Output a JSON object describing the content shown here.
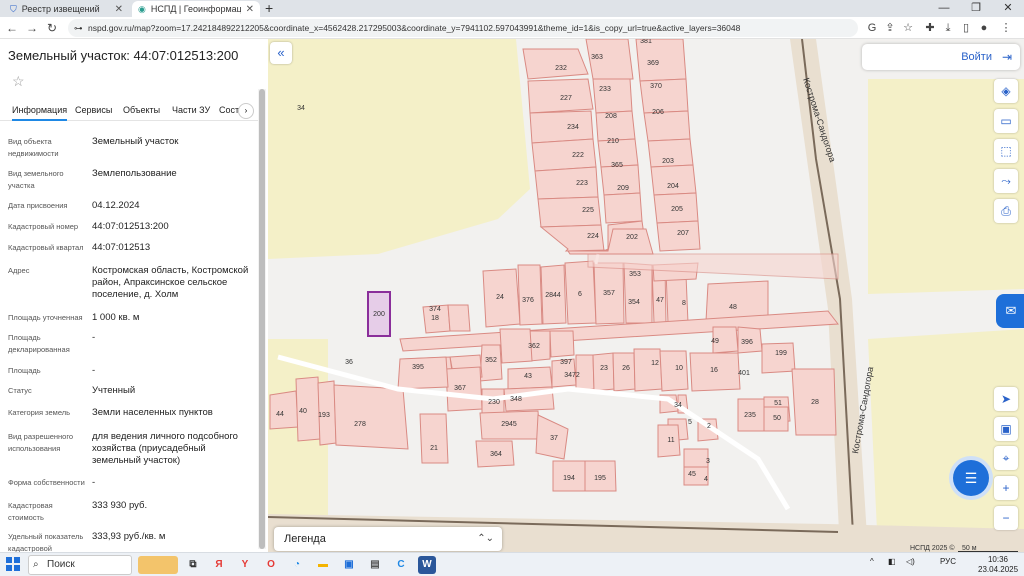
{
  "browser": {
    "tabs": [
      {
        "title": "Реестр извещений",
        "active": false
      },
      {
        "title": "НСПД | Геоинформационный",
        "active": true
      }
    ],
    "new_tab": "+",
    "url": "nspd.gov.ru/map?zoom=17.242184892212205&coordinate_x=4562428.217295003&coordinate_y=7941102.597043991&theme_id=1&is_copy_url=true&active_layers=36048"
  },
  "panel": {
    "title": "Земельный участок: 44:07:012513:200",
    "tabs": [
      "Информация",
      "Сервисы",
      "Объекты",
      "Части ЗУ",
      "Сост"
    ],
    "active_tab": "Информация",
    "properties": [
      {
        "label": "Вид объекта недвижимости",
        "value": "Земельный участок"
      },
      {
        "label": "Вид земельного участка",
        "value": "Землепользование"
      },
      {
        "label": "Дата присвоения",
        "value": "04.12.2024"
      },
      {
        "label": "Кадастровый номер",
        "value": "44:07:012513:200"
      },
      {
        "label": "Кадастровый квартал",
        "value": "44:07:012513"
      },
      {
        "label": "Адрес",
        "value": "Костромская область, Костромской район, Апраксинское сельское поселение, д. Холм"
      },
      {
        "label": "Площадь уточненная",
        "value": "1 000 кв. м"
      },
      {
        "label": "Площадь декларированная",
        "value": "-"
      },
      {
        "label": "Площадь",
        "value": "-"
      },
      {
        "label": "Статус",
        "value": "Учтенный"
      },
      {
        "label": "Категория земель",
        "value": "Земли населенных пунктов"
      },
      {
        "label": "Вид разрешенного использования",
        "value": "для ведения личного подсобного хозяйства (приусадебный земельный участок)"
      },
      {
        "label": "Форма собственности",
        "value": "-"
      },
      {
        "label": "Кадастровая стоимость",
        "value": "333 930 руб."
      },
      {
        "label": "Удельный показатель кадастровой",
        "value": "333,93 руб./кв. м"
      }
    ]
  },
  "map": {
    "login_label": "Войти",
    "legend_label": "Легенда",
    "road_label": "Кострома-Сандогора",
    "copyright": "НСПД 2025 ©",
    "scale": "50 м",
    "selected_parcel": "200",
    "parcel_labels": [
      "381",
      "363",
      "232",
      "369",
      "233",
      "227",
      "370",
      "208",
      "234",
      "206",
      "210",
      "222",
      "203",
      "365",
      "223",
      "204",
      "209",
      "225",
      "205",
      "202",
      "224",
      "207",
      "353",
      "24",
      "376",
      "2844",
      "6",
      "357",
      "354",
      "47",
      "8",
      "374",
      "18",
      "48",
      "200",
      "49",
      "396",
      "362",
      "352",
      "397",
      "199",
      "395",
      "3472",
      "23",
      "26",
      "12",
      "10",
      "16",
      "401",
      "367",
      "43",
      "34",
      "230",
      "348",
      "51",
      "28",
      "50",
      "235",
      "44",
      "40",
      "193",
      "278",
      "2945",
      "5",
      "2",
      "37",
      "11",
      "21",
      "364",
      "3",
      "45",
      "4",
      "194",
      "195",
      "34",
      "36"
    ]
  },
  "taskbar": {
    "search_label": "Поиск",
    "language": "РУС",
    "time": "10:36",
    "date": "23.04.2025"
  },
  "colors": {
    "accent": "#1e6fd9",
    "parcel_fill": "#f6d4cf",
    "parcel_stroke": "#d98a83",
    "selected_fill": "#e6cde8",
    "selected_stroke": "#8a2e9a",
    "field": "#f4f0c8"
  }
}
